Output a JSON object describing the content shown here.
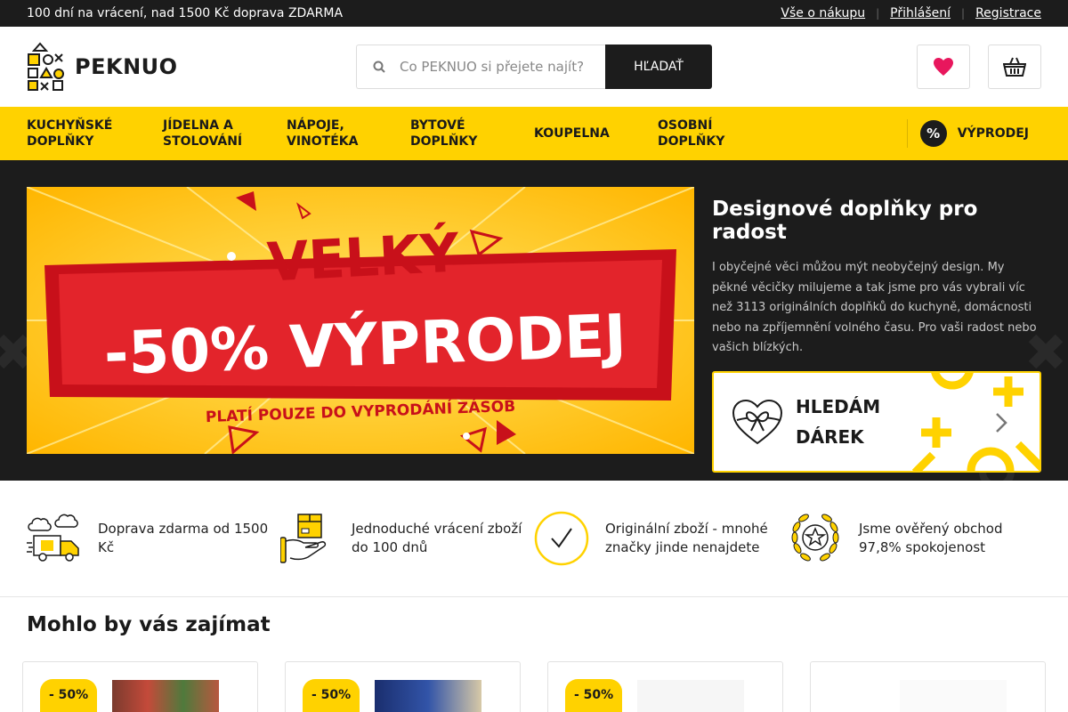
{
  "topbar": {
    "promo": "100 dní na vrácení, nad 1500 Kč doprava ZDARMA",
    "links": [
      "Vše o nákupu",
      "Přihlášení",
      "Registrace"
    ]
  },
  "header": {
    "logo_text": "PEKNUO",
    "search_placeholder": "Co PEKNUO si přejete najít?",
    "search_button": "HĽADAŤ"
  },
  "nav": {
    "items": [
      "KUCHYŇSKÉ DOPLŇKY",
      "JÍDELNA A STOLOVÁNÍ",
      "NÁPOJE, VINOTÉKA",
      "BYTOVÉ DOPLŇKY",
      "KOUPELNA",
      "OSOBNÍ DOPLŇKY"
    ],
    "sale_badge": "%",
    "sale_label": "VÝPRODEJ"
  },
  "hero": {
    "banner_line1": "VELKÝ",
    "banner_line2": "-50% VÝPRODEJ",
    "banner_line3": "PLATÍ  POUZE DO VYPRODÁNÍ ZÁSOB",
    "title": "Designové doplňky pro radost",
    "text": "I obyčejné věci můžou mýt neobyčejný design. My pěkné věcičky milujeme a tak jsme pro vás vybrali víc než 3113 originálních doplňků do kuchyně, domácnosti nebo na zpříjemnění volného času. Pro vaši radost nebo vašich blízkých.",
    "gift_label": "HLEDÁM DÁREK"
  },
  "benefits": [
    {
      "icon": "delivery-truck-icon",
      "text": "Doprava zdarma od 1500 Kč"
    },
    {
      "icon": "return-box-icon",
      "text": "Jednoduché vrácení zboží do 100 dnů"
    },
    {
      "icon": "checkmark-icon",
      "text": "Originální zboží - mnohé značky jinde nenajdete"
    },
    {
      "icon": "award-star-icon",
      "text": "Jsme ověřený obchod 97,8% spokojenost"
    }
  ],
  "recommended": {
    "title": "Mohlo by vás zajímat",
    "badges": [
      "- 50%",
      "- 50%",
      "- 50%"
    ]
  },
  "colors": {
    "accent": "#ffd200",
    "dark": "#1c1c1c",
    "banner_red": "#d4181e"
  }
}
